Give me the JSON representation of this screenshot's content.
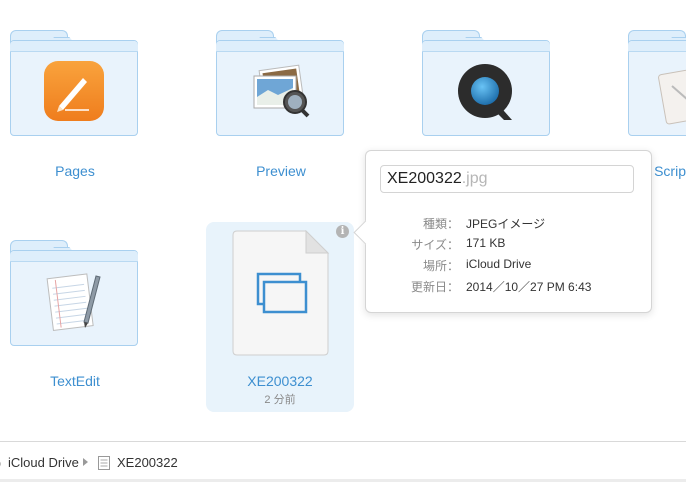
{
  "items": [
    {
      "label": "Pages",
      "icon": "pages-app-icon"
    },
    {
      "label": "Preview",
      "icon": "preview-app-icon"
    },
    {
      "label": "",
      "icon": "quicktime-app-icon"
    },
    {
      "label": "Scrip",
      "icon": "script-editor-app-icon"
    },
    {
      "label": "TextEdit",
      "icon": "textedit-app-icon"
    },
    {
      "label": "XE200322",
      "sublabel": "2 分前",
      "icon": "image-document-icon"
    }
  ],
  "popover": {
    "name_base": "XE200322",
    "name_ext": ".jpg",
    "rows": [
      {
        "key": "種類：",
        "value": "JPEGイメージ"
      },
      {
        "key": "サイズ：",
        "value": "171 KB"
      },
      {
        "key": "場所：",
        "value": "iCloud Drive"
      },
      {
        "key": "更新日：",
        "value": "2014／10／27 PM 6:43"
      }
    ]
  },
  "breadcrumb": {
    "root": "iCloud Drive",
    "file": "XE200322"
  },
  "colors": {
    "label": "#3d8fd0",
    "folder_fill": "#e9f3fc",
    "folder_border": "#a9d0ef",
    "selected_bg": "#e8f3fb"
  }
}
